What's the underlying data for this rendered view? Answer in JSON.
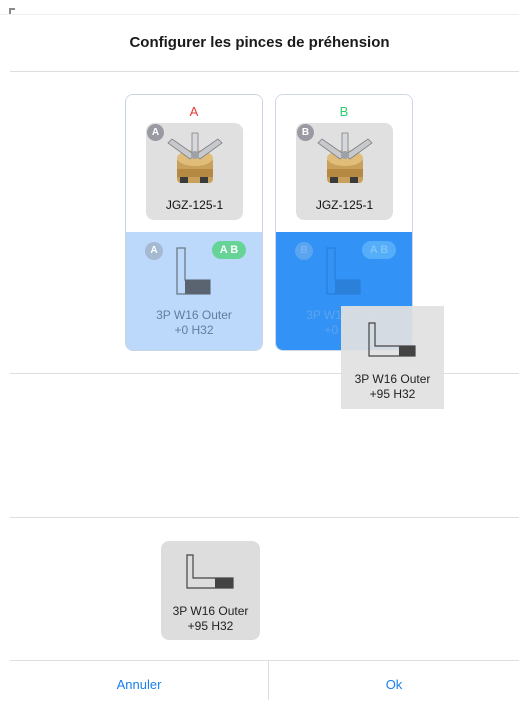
{
  "dialog": {
    "title": "Configurer les pinces de préhension"
  },
  "slots": [
    {
      "letter": "A",
      "letter_color": "#e53935",
      "badge": "A",
      "gripper": {
        "name": "JGZ-125-1",
        "icon": "gripper-icon"
      },
      "finger": {
        "badge_left": "A",
        "badge_right": "A B",
        "line1": "3P W16 Outer",
        "line2": "+0 H32",
        "icon": "finger-icon",
        "state": "assigned"
      }
    },
    {
      "letter": "B",
      "letter_color": "#2ecc71",
      "badge": "B",
      "gripper": {
        "name": "JGZ-125-1",
        "icon": "gripper-icon"
      },
      "finger": {
        "badge_left": "B",
        "badge_right": "A B",
        "line1": "3P W16 Outer",
        "line2": "+0 H32",
        "icon": "finger-icon",
        "state": "drop-target"
      }
    }
  ],
  "drag_ghost": {
    "line1": "3P W16 Outer",
    "line2": "+95 H32",
    "icon": "finger-icon"
  },
  "palette": [
    {
      "line1": "3P W16 Outer",
      "line2": "+95 H32",
      "icon": "finger-icon"
    }
  ],
  "footer": {
    "cancel_label": "Annuler",
    "ok_label": "Ok"
  },
  "colors": {
    "accent": "#1a7ff0",
    "slot_a_fill": "#bcd9fb",
    "slot_b_fill": "#3392f5",
    "tile_gray": "#dddddd"
  }
}
